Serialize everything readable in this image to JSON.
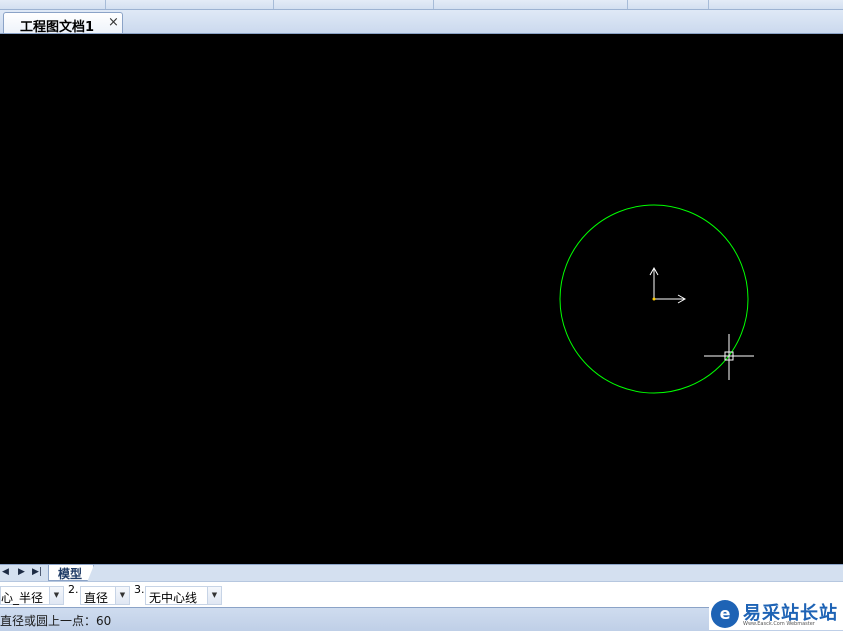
{
  "document_tab": {
    "title": "工程图文档1",
    "close_glyph": "×"
  },
  "canvas": {
    "background": "#000000",
    "circle_color": "#00ff00",
    "axis_color": "#ffffff",
    "cursor_color": "#ffffff"
  },
  "layout_bar": {
    "nav_first": "◀",
    "nav_next": "▶",
    "nav_last": "▶|",
    "model_tab": "模型"
  },
  "command_options": [
    {
      "num": "",
      "value": "心_半径"
    },
    {
      "num": "2.",
      "value": "直径"
    },
    {
      "num": "3.",
      "value": "无中心线"
    }
  ],
  "status": {
    "prompt": "直径或圆上一点：60"
  },
  "watermark": {
    "title": "易采站长站",
    "subtitle": "Www.Easck.Com Webmaster",
    "logo_glyph": "e"
  }
}
